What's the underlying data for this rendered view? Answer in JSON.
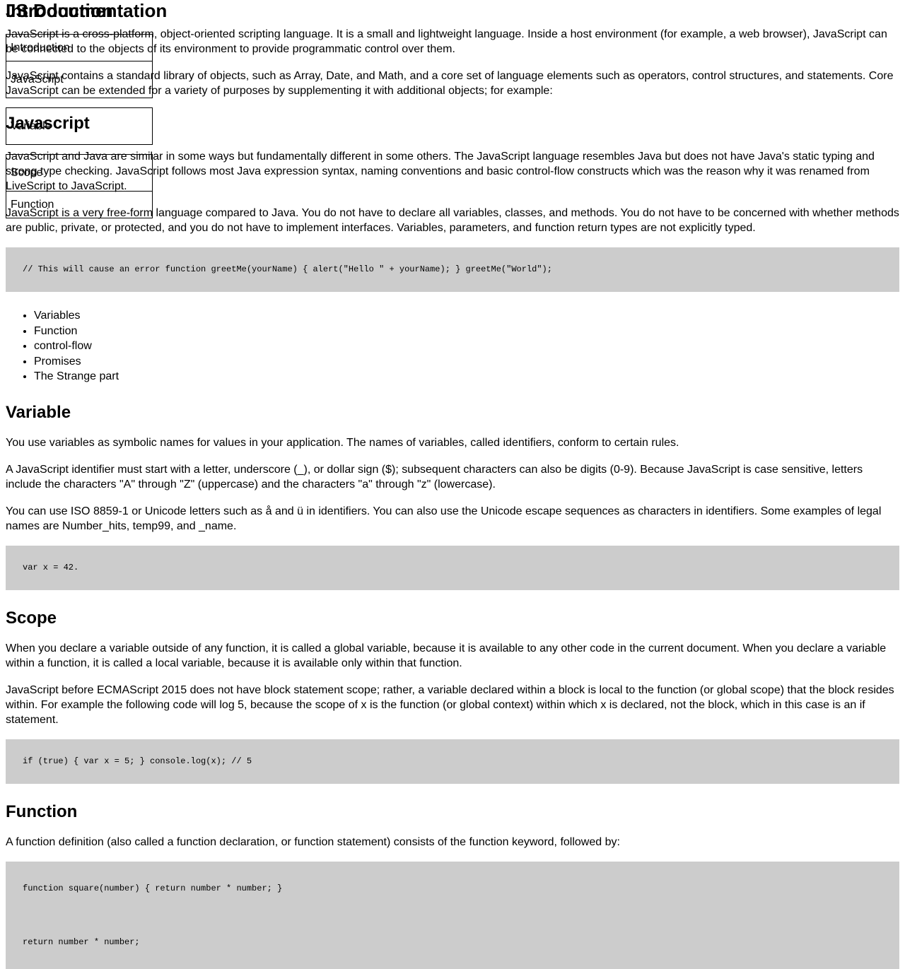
{
  "document": {
    "doc_title": "JS Documentation",
    "intro_title": "Introduction"
  },
  "navbar": {
    "items": [
      {
        "label": "Introduction"
      },
      {
        "label": "JavaScript"
      },
      {
        "label": "Variable"
      },
      {
        "label": "Scope"
      },
      {
        "label": "Function"
      }
    ]
  },
  "sections": {
    "introduction": {
      "paragraphs": [
        "JavaScript is a cross-platform, object-oriented scripting language. It is a small and lightweight language. Inside a host environment (for example, a web browser), JavaScript can be connected to the objects of its environment to provide programmatic control over them.",
        "JavaScript contains a standard library of objects, such as Array, Date, and Math, and a core set of language elements such as operators, control structures, and statements. Core JavaScript can be extended for a variety of purposes by supplementing it with additional objects; for example:"
      ]
    },
    "javascript": {
      "heading": "Javascript",
      "paragraphs": [
        "JavaScript and Java are similar in some ways but fundamentally different in some others. The JavaScript language resembles Java but does not have Java's static typing and strong type checking. JavaScript follows most Java expression syntax, naming conventions and basic control-flow constructs which was the reason why it was renamed from LiveScript to JavaScript.",
        "JavaScript is a very free-form language compared to Java. You do not have to declare all variables, classes, and methods. You do not have to be concerned with whether methods are public, private, or protected, and you do not have to implement interfaces. Variables, parameters, and function return types are not explicitly typed."
      ],
      "code": "// This will cause an error function greetMe(yourName) { alert(\"Hello \" + yourName); } greetMe(\"World\");",
      "list": [
        "Variables",
        "Function",
        "control-flow",
        "Promises",
        "The Strange part"
      ]
    },
    "variable": {
      "heading": "Variable",
      "paragraphs": [
        "You use variables as symbolic names for values in your application. The names of variables, called identifiers, conform to certain rules.",
        "A JavaScript identifier must start with a letter, underscore (_), or dollar sign ($); subsequent characters can also be digits (0-9). Because JavaScript is case sensitive, letters include the characters \"A\" through \"Z\" (uppercase) and the characters \"a\" through \"z\" (lowercase).",
        "You can use ISO 8859-1 or Unicode letters such as å and ü in identifiers. You can also use the Unicode escape sequences as characters in identifiers. Some examples of legal names are Number_hits, temp99, and _name."
      ],
      "code": "var x = 42."
    },
    "scope": {
      "heading": "Scope",
      "paragraphs": [
        "When you declare a variable outside of any function, it is called a global variable, because it is available to any other code in the current document. When you declare a variable within a function, it is called a local variable, because it is available only within that function.",
        "JavaScript before ECMAScript 2015 does not have block statement scope; rather, a variable declared within a block is local to the function (or global scope) that the block resides within. For example the following code will log 5, because the scope of x is the function (or global context) within which x is declared, not the block, which in this case is an if statement."
      ],
      "code": "if (true) { var x = 5; } console.log(x); // 5"
    },
    "function": {
      "heading": "Function",
      "paragraphs": [
        "A function definition (also called a function declaration, or function statement) consists of the function keyword, followed by:"
      ],
      "code_1": "function square(number) { return number * number; }",
      "code_2": "return number * number;"
    }
  },
  "colors": {
    "code_background": "#cccccc",
    "text": "#000000",
    "page_background": "#ffffff",
    "nav_border": "#000000"
  }
}
